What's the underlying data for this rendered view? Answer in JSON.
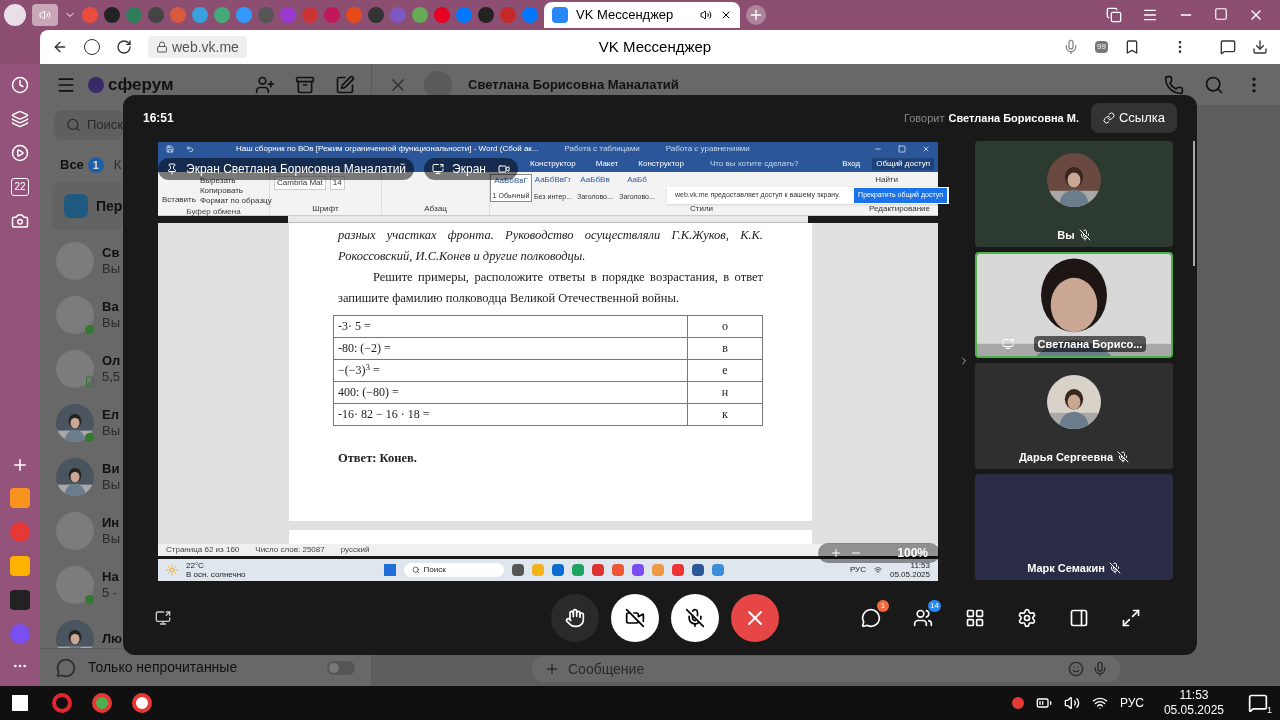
{
  "browser": {
    "active_tab": {
      "title": "VK Мессенджер"
    },
    "address": "web.vk.me",
    "page_title": "VK Мессенджер",
    "extension_badge": "99",
    "sidebar_calendar": "22"
  },
  "vk": {
    "logo": "сферум",
    "search": {
      "placeholder": "Поиск"
    },
    "filters": [
      {
        "label": "Все",
        "badge": "1",
        "selected": true
      },
      {
        "label": "К",
        "selected": false
      }
    ],
    "pinned": {
      "title": "Пер"
    },
    "chats": [
      {
        "name": "Св",
        "preview": "Вы",
        "online": false,
        "mobile": false,
        "photo": false
      },
      {
        "name": "Ва",
        "preview": "Вы",
        "online": true,
        "mobile": false,
        "photo": false
      },
      {
        "name": "Ол",
        "preview": "5,5",
        "online": false,
        "mobile": true,
        "photo": false
      },
      {
        "name": "Ел",
        "preview": "Вы",
        "online": true,
        "mobile": false,
        "photo": true
      },
      {
        "name": "Ви",
        "preview": "Вы",
        "online": false,
        "mobile": false,
        "photo": true
      },
      {
        "name": "Ин",
        "preview": "Вы",
        "online": false,
        "mobile": false,
        "photo": false
      },
      {
        "name": "На",
        "preview": "5 -",
        "online": true,
        "mobile": false,
        "photo": false
      },
      {
        "name": "Лю",
        "online": false,
        "mobile": false,
        "photo": true
      }
    ],
    "unread_only": {
      "label": "Только непрочитанные",
      "on": false
    },
    "chat_header": {
      "name": "Светлана Борисовна Маналатий"
    },
    "composer": {
      "placeholder": "Сообщение"
    }
  },
  "call": {
    "time": "16:51",
    "speaker_label": "Говорит",
    "speaker": "Светлана Борисовна М.",
    "link_button": "Ссылка",
    "screen": {
      "presenter_label": "Экран Светлана Борисовна Маналатий",
      "screen_label": "Экран",
      "word": {
        "title": "Наш сборник по ВОв [Режим ограниченной функциональности] - Word (Сбой ак...",
        "context_tabs": [
          "Работа с таблицами",
          "Работа с уравнениями"
        ],
        "tabs": [
          {
            "label": "Конструктор",
            "selected": false
          },
          {
            "label": "Макет",
            "selected": false
          },
          {
            "label": "Конструктор",
            "selected": false
          }
        ],
        "tell_me": "Что вы хотите сделать?",
        "sign_in": "Вход",
        "share": "Общий доступ",
        "clipboard": {
          "paste": "Вставить",
          "items": [
            "Вырезать",
            "Копировать",
            "Формат по образцу"
          ],
          "group": "Буфер обмена"
        },
        "font": {
          "name": "Cambria Mat",
          "size": "14",
          "group": "Шрифт"
        },
        "paragraph_group": "Абзац",
        "styles": [
          {
            "sample": "АаБбВвГ",
            "name": "1 Обычный",
            "selected": true
          },
          {
            "sample": "АаБбВвГг",
            "name": "Без интер...",
            "selected": false
          },
          {
            "sample": "АаБбВв",
            "name": "Заголово...",
            "selected": false
          },
          {
            "sample": "АаБб",
            "name": "Заголово...",
            "selected": false
          }
        ],
        "styles_group": "Стили",
        "find": "Найти",
        "editing_group": "Редактирование",
        "document": {
          "intro": "разных участках фронта. Руководство осуществляли Г.К.Жуков, К.К. Рокоссовский, И.С.Конев и другие полководцы.",
          "task": "Решите примеры, расположите ответы в порядке возрастания, в ответ запишите фамилию полководца Великой Отечественной войны.",
          "rows": [
            {
              "expression": "-3· 5 =",
              "letter": "о"
            },
            {
              "expression": "-80: (−2) =",
              "letter": "в"
            },
            {
              "expression": "−(−3)$^{3}$ =",
              "letter": "е"
            },
            {
              "expression": "400: (−80) =",
              "letter": "н"
            },
            {
              "expression": "-16· 82 − 16 · 18 =",
              "letter": "к"
            }
          ],
          "answer": "Ответ: Конев."
        },
        "status": [
          "Страница 62 из 160",
          "Число слов: 25087",
          "русский"
        ],
        "zoom": "100%"
      },
      "share_banner": {
        "text": "web.vk.me предоставляет доступ к вашему экрану.",
        "button": "Прекратить общий доступ"
      },
      "taskbar": {
        "weather": "22°C",
        "weather_text": "В осн. солнечно",
        "search": "Поиск",
        "lang": "РУС",
        "time": "11:53",
        "date": "05.05.2025"
      }
    },
    "participants": [
      {
        "name": "Вы",
        "kind": "avatar",
        "muted": true,
        "selected": false
      },
      {
        "name": "Светлана Борисо...",
        "kind": "video",
        "muted": false,
        "selected": true
      },
      {
        "name": "Дарья Сергеевна",
        "kind": "avatar",
        "muted": true,
        "selected": false
      },
      {
        "name": "Марк Семакин",
        "kind": "blank",
        "muted": true,
        "selected": false
      }
    ],
    "camera_on": false,
    "mic_on": false,
    "chat_badge": "1",
    "participants_badge": "14"
  },
  "os_taskbar": {
    "lang": "РУС",
    "time": "11:53",
    "date": "05.05.2025",
    "notifications": "1"
  }
}
